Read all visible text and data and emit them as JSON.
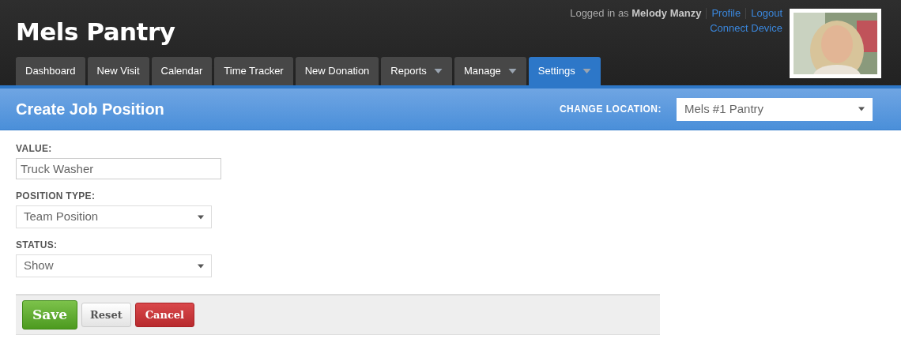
{
  "app": {
    "title": "Mels Pantry"
  },
  "user_bar": {
    "logged_in": "Logged in as **Melody Manzy**",
    "links": [
      "Profile",
      "Logout"
    ],
    "connect": "Connect Device",
    "avatar": {
      "kind": "picture"
    }
  },
  "tabs": [
    {
      "label": "Dashboard",
      "selected": false,
      "dropdown": false
    },
    {
      "label": "New Visit",
      "selected": false,
      "dropdown": false
    },
    {
      "label": "Calendar",
      "selected": false,
      "dropdown": false
    },
    {
      "label": "Time Tracker",
      "selected": false,
      "dropdown": false
    },
    {
      "label": "New Donation",
      "selected": false,
      "dropdown": false
    },
    {
      "label": "Reports",
      "selected": false,
      "dropdown": true
    },
    {
      "label": "Manage",
      "selected": false,
      "dropdown": true
    },
    {
      "label": "Settings",
      "selected": true,
      "dropdown": true
    }
  ],
  "page": {
    "title": "Create Job Position",
    "location_label": "CHANGE LOCATION:",
    "location_value": "Mels #1 Pantry"
  },
  "form": {
    "fields": [
      {
        "kind": "text",
        "label": "VALUE:",
        "value": "Truck Washer"
      },
      {
        "kind": "select",
        "label": "POSITION TYPE:",
        "value": "Team Position"
      },
      {
        "kind": "select",
        "label": "STATUS:",
        "value": "Show"
      }
    ],
    "buttons": [
      {
        "kind": "save",
        "label": "Save"
      },
      {
        "kind": "reset",
        "label": "Reset"
      },
      {
        "kind": "cancel",
        "label": "Cancel"
      }
    ]
  }
}
